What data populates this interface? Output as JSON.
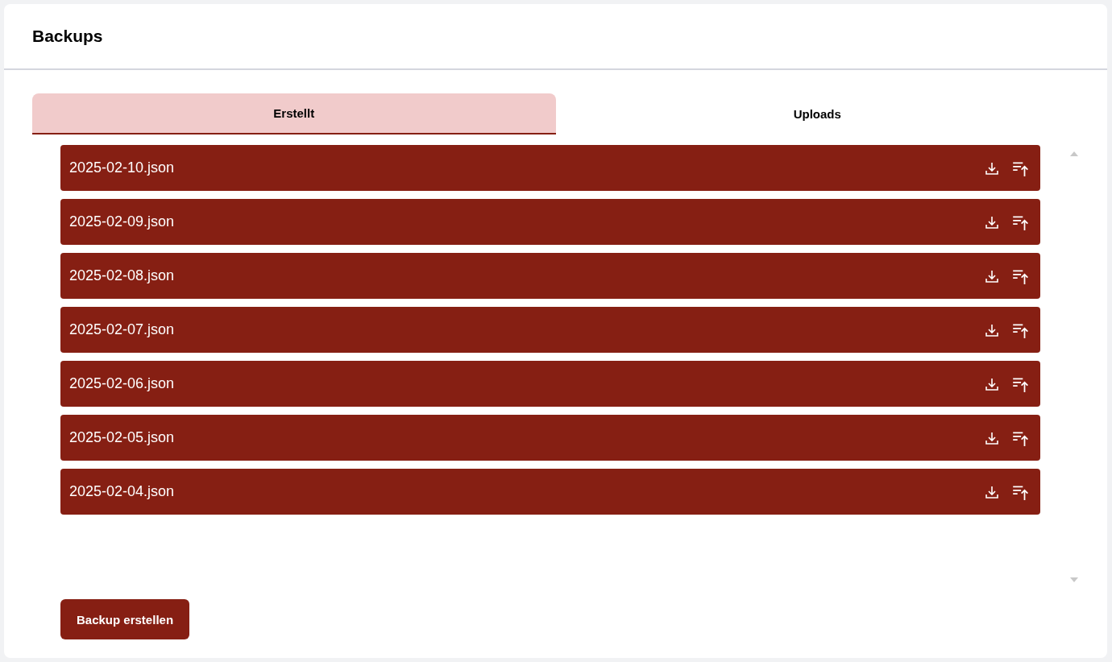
{
  "page": {
    "title": "Backups"
  },
  "tabs": [
    {
      "label": "Erstellt",
      "selected": true
    },
    {
      "label": "Uploads",
      "selected": false
    }
  ],
  "backups": [
    {
      "name": "2025-02-10.json"
    },
    {
      "name": "2025-02-09.json"
    },
    {
      "name": "2025-02-08.json"
    },
    {
      "name": "2025-02-07.json"
    },
    {
      "name": "2025-02-06.json"
    },
    {
      "name": "2025-02-05.json"
    },
    {
      "name": "2025-02-04.json"
    }
  ],
  "create_button": {
    "label": "Backup erstellen"
  }
}
